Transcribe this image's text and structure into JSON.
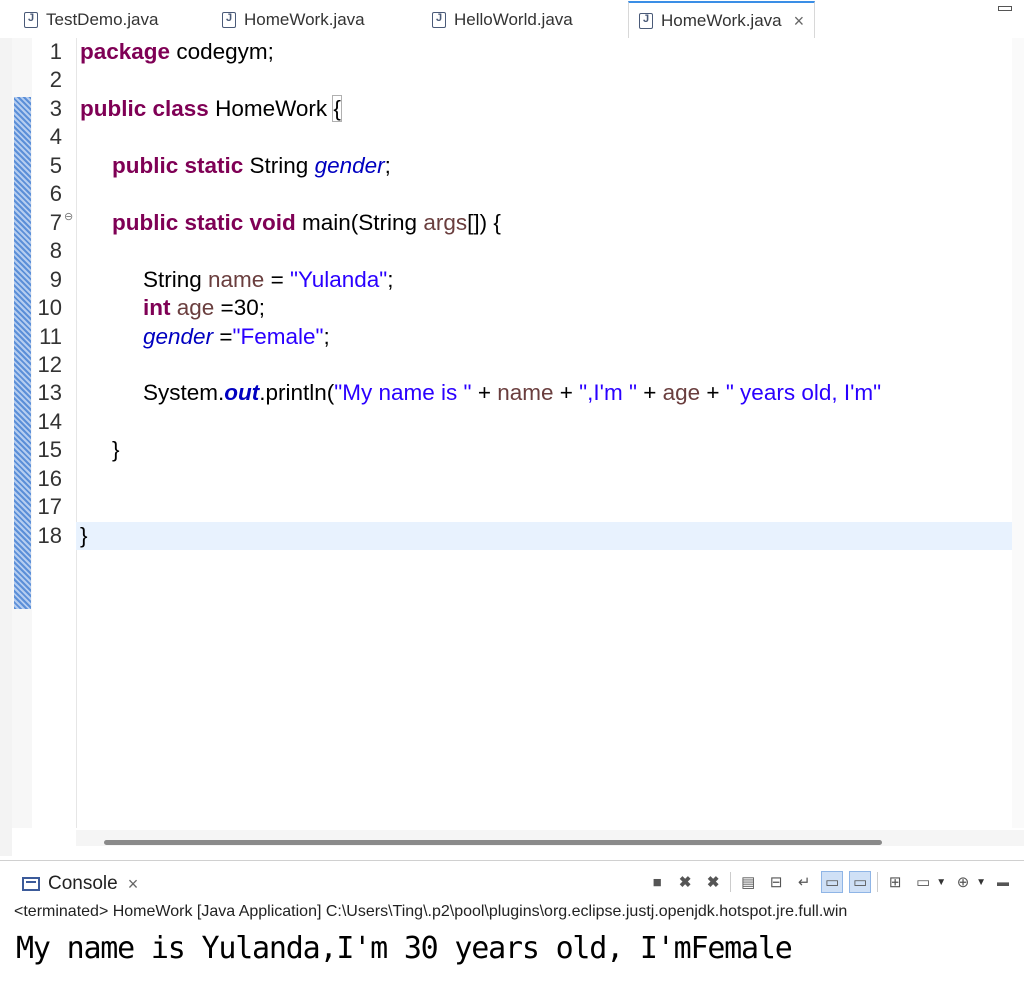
{
  "tabs": [
    {
      "label": "TestDemo.java",
      "active": false
    },
    {
      "label": "HomeWork.java",
      "active": false
    },
    {
      "label": "HelloWorld.java",
      "active": false
    },
    {
      "label": "HomeWork.java",
      "active": true
    }
  ],
  "editor": {
    "line_numbers": [
      "1",
      "2",
      "3",
      "4",
      "5",
      "6",
      "7",
      "8",
      "9",
      "10",
      "11",
      "12",
      "13",
      "14",
      "15",
      "16",
      "17",
      "18"
    ],
    "code": {
      "l1_kw": "package",
      "l1_rest": " codegym;",
      "l3_kw": "public class",
      "l3_name": " HomeWork ",
      "l3_brace": "{",
      "l5_kw": "public static",
      "l5_type": " String ",
      "l5_field": "gender",
      "l5_end": ";",
      "l7_kw": "public static void",
      "l7_rest1": " main(String ",
      "l7_args": "args",
      "l7_rest2": "[]) {",
      "l9_type": "String ",
      "l9_var": "name",
      "l9_eq": " = ",
      "l9_str": "\"Yulanda\"",
      "l9_end": ";",
      "l10_kw": "int",
      "l10_var": " age",
      "l10_rest": " =30;",
      "l11_field": "gender",
      "l11_eq": " =",
      "l11_str": "\"Female\"",
      "l11_end": ";",
      "l13_sys": "System.",
      "l13_out": "out",
      "l13_println": ".println(",
      "l13_s1": "\"My name is \"",
      "l13_p1": " + ",
      "l13_name": "name",
      "l13_p2": " + ",
      "l13_s2": "\",I'm \"",
      "l13_p3": " + ",
      "l13_age": "age",
      "l13_p4": " + ",
      "l13_s3": "\" years old, I'm\"",
      "l15_brace": "}",
      "l18_brace": "}"
    }
  },
  "console": {
    "tab_label": "Console",
    "terminated_line": "<terminated> HomeWork [Java Application] C:\\Users\\Ting\\.p2\\pool\\plugins\\org.eclipse.justj.openjdk.hotspot.jre.full.win",
    "output": "My name is Yulanda,I'm 30 years old, I'mFemale"
  },
  "icons": {
    "tab_file": "java-file-icon",
    "close": "close-icon",
    "console": "console-icon",
    "toolbar": [
      "terminate-icon",
      "remove-launch-icon",
      "remove-all-terminated-icon",
      "clear-console-icon",
      "scroll-lock-icon",
      "word-wrap-icon",
      "show-on-stdout-icon",
      "show-on-stderr-icon",
      "pin-console-icon",
      "display-selected-console-icon",
      "open-console-icon",
      "minimize-icon"
    ]
  }
}
